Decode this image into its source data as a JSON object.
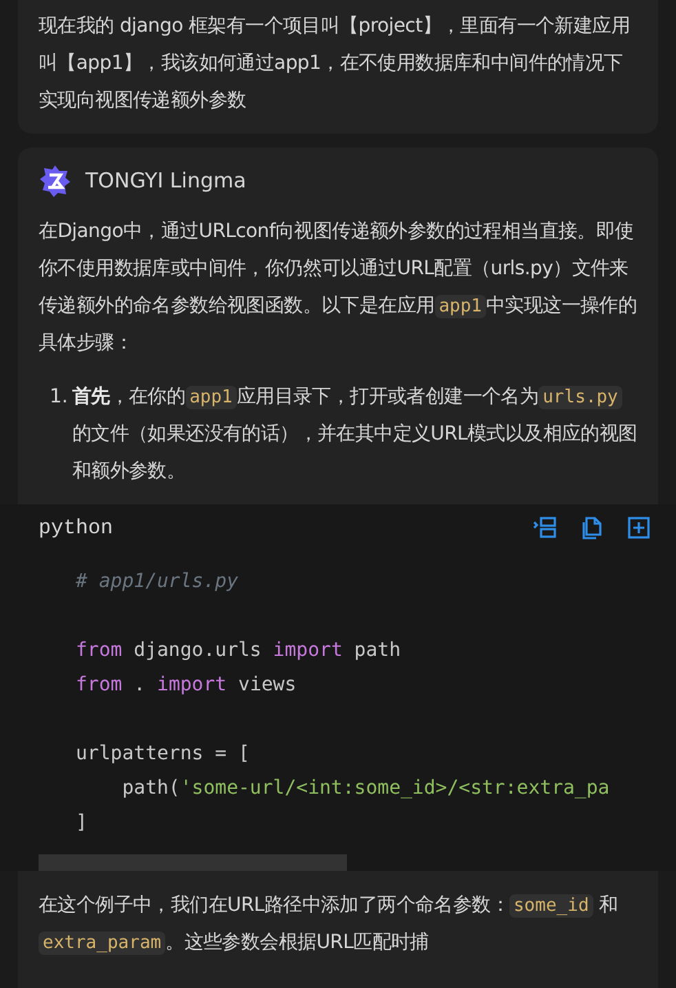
{
  "user_message": {
    "text": "现在我的 django 框架有一个项目叫【project】，里面有一个新建应用叫【app1】，我该如何通过app1，在不使用数据库和中间件的情况下实现向视图传递额外参数"
  },
  "assistant": {
    "name": "TONGYI Lingma",
    "intro": [
      {
        "kind": "text",
        "text": "在Django中，通过URLconf向视图传递额外参数的过程相当直接。即使你不使用数据库或中间件，你仍然可以通过URL配置（urls.py）文件来传递额外的命名参数给视图函数。以下是在应用"
      },
      {
        "kind": "code",
        "text": "app1"
      },
      {
        "kind": "text",
        "text": "中实现这一操作的具体步骤："
      }
    ],
    "steps": [
      {
        "number": "1.",
        "segments": [
          {
            "kind": "bold",
            "text": "首先"
          },
          {
            "kind": "text",
            "text": "，在你的"
          },
          {
            "kind": "code",
            "text": "app1"
          },
          {
            "kind": "text",
            "text": "应用目录下，打开或者创建一个名为"
          },
          {
            "kind": "code",
            "text": "urls.py"
          },
          {
            "kind": "text",
            "text": "的文件（如果还没有的话），并在其中定义URL模式以及相应的视图和额外参数。"
          }
        ]
      }
    ],
    "code_block": {
      "language": "python",
      "lines": [
        [
          {
            "kind": "comment",
            "text": "# app1/urls.py"
          }
        ],
        [
          {
            "kind": "blank"
          }
        ],
        [
          {
            "kind": "keyword",
            "text": "from"
          },
          {
            "kind": "plain",
            "text": " django.urls "
          },
          {
            "kind": "keyword",
            "text": "import"
          },
          {
            "kind": "plain",
            "text": " path"
          }
        ],
        [
          {
            "kind": "keyword",
            "text": "from"
          },
          {
            "kind": "plain",
            "text": " . "
          },
          {
            "kind": "keyword",
            "text": "import"
          },
          {
            "kind": "plain",
            "text": " views"
          }
        ],
        [
          {
            "kind": "blank"
          }
        ],
        [
          {
            "kind": "plain",
            "text": "urlpatterns = ["
          }
        ],
        [
          {
            "kind": "plain",
            "text": "    path("
          },
          {
            "kind": "string",
            "text": "'some-url/<int:some_id>/<str:extra_pa"
          }
        ],
        [
          {
            "kind": "plain",
            "text": "]"
          }
        ]
      ]
    },
    "outro": [
      {
        "kind": "text",
        "text": "在这个例子中，我们在URL路径中添加了两个命名参数："
      },
      {
        "kind": "code",
        "text": "some_id"
      },
      {
        "kind": "text",
        "text": " 和 "
      },
      {
        "kind": "code",
        "text": "extra_param"
      },
      {
        "kind": "text",
        "text": "。这些参数会根据URL匹配时捕"
      }
    ]
  }
}
